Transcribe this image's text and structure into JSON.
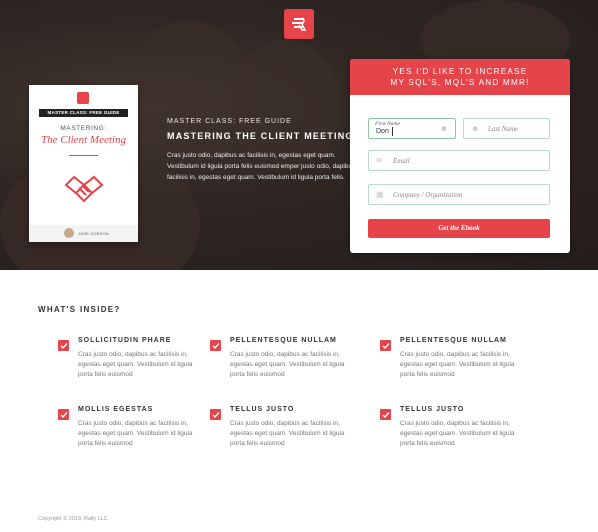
{
  "colors": {
    "accent": "#e5444a",
    "hero_dark": "#2a2220",
    "field_border": "#b9dcc6"
  },
  "book": {
    "tag": "MASTER CLASS: FREE GUIDE",
    "mastering": "MASTERING:",
    "title": "The Client Meeting",
    "author": "JANE DOBSON"
  },
  "hero": {
    "kicker": "MASTER CLASS: FREE GUIDE",
    "headline": "MASTERING THE CLIENT MEETING",
    "body": "Cras justo odio, dapibus ac facilisis in, egestas eget quam. Vestibulum id ligula porta felis euismod emper justo odio, dapibus ac facilisis in, egestas eget quam. Vestibulum id ligula porta felis."
  },
  "form": {
    "heading_line1": "YES I'D LIKE TO INCREASE",
    "heading_line2": "MY SQL'S, MQL'S AND MMR!",
    "first_name_label": "First Name",
    "first_name_value": "Don",
    "last_name_placeholder": "Last Name",
    "email_placeholder": "Email",
    "company_placeholder": "Company / Organization",
    "submit_label": "Get the Ebook"
  },
  "inside": {
    "title": "WHAT'S INSIDE?",
    "features": [
      {
        "title": "SOLLICITUDIN PHARE",
        "body": "Cras justo odio, dapibus ac facilisis in, egestas eget quam. Vestibulum id ligula porta felis euismod"
      },
      {
        "title": "PELLENTESQUE NULLAM",
        "body": "Cras justo odio, dapibus ac facilisis in, egestas eget quam. Vestibulum id ligula porta felis euismod"
      },
      {
        "title": "PELLENTESQUE NULLAM",
        "body": "Cras justo odio, dapibus ac facilisis in, egestas eget quam. Vestibulum id ligula porta felis euismod"
      },
      {
        "title": "MOLLIS EGESTAS",
        "body": "Cras justo odio, dapibus ac facilisis in, egestas eget quam. Vestibulum id ligula porta felis euismod"
      },
      {
        "title": "TELLUS JUSTO",
        "body": "Cras justo odio, dapibus ac facilisis in, egestas eget quam. Vestibulum id ligula porta felis euismod"
      },
      {
        "title": "TELLUS JUSTO",
        "body": "Cras justo odio, dapibus ac facilisis in, egestas eget quam. Vestibulum id ligula porta felis euismod"
      }
    ]
  },
  "footer": {
    "copyright": "Copyright © 2019, Rally LLC"
  },
  "icons": {
    "logo": "brand-logo-icon",
    "user": "user-icon",
    "email": "envelope-icon",
    "company": "building-icon",
    "check": "check-icon"
  }
}
